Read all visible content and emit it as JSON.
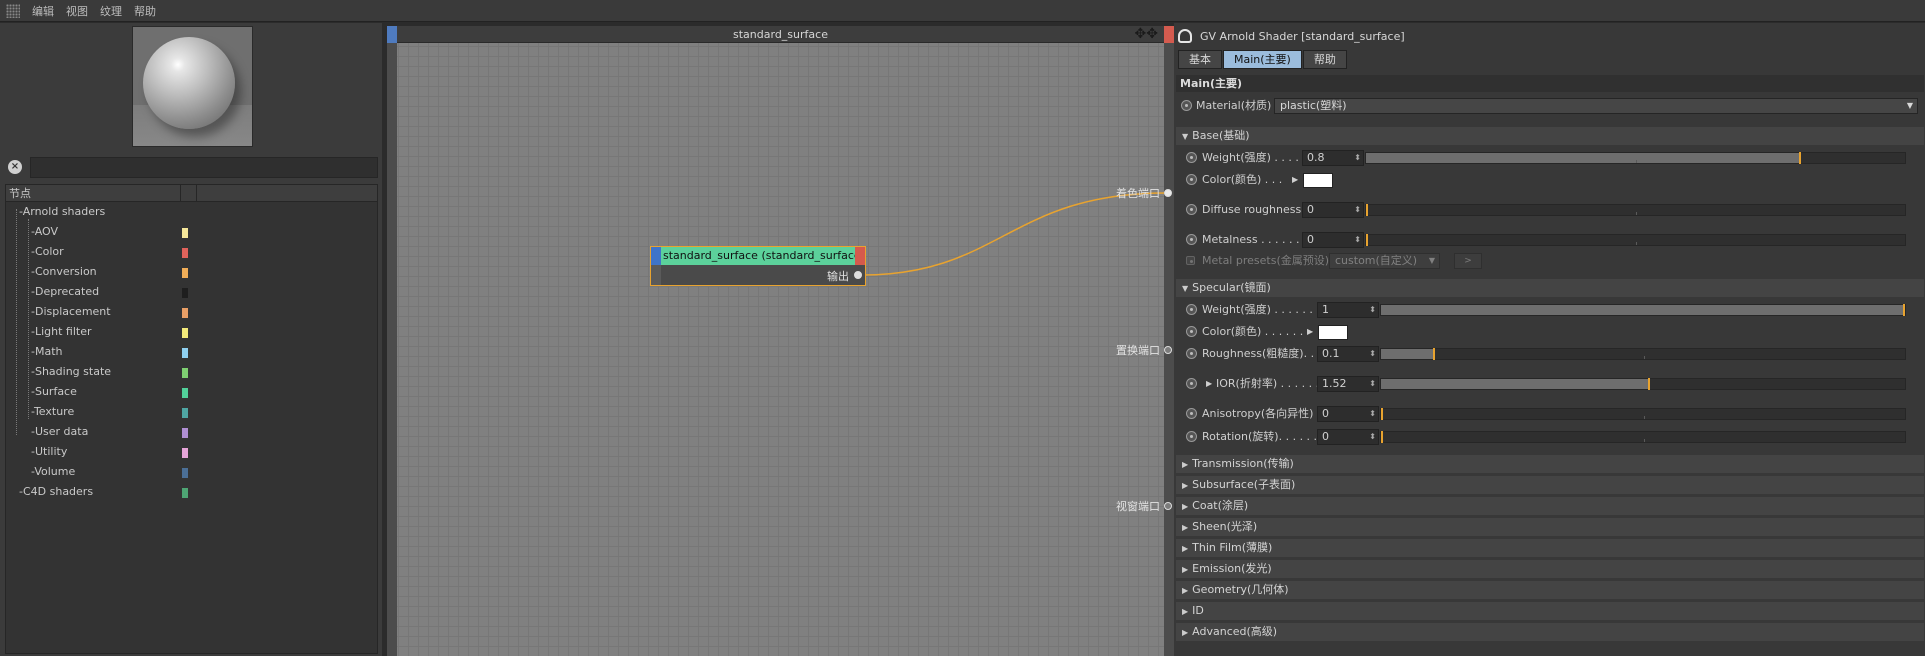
{
  "menubar": {
    "items": [
      "编辑",
      "视图",
      "纹理",
      "帮助"
    ]
  },
  "left": {
    "tree_header": "节点",
    "categories": [
      {
        "label": "-Arnold shaders"
      },
      {
        "label": "-AOV",
        "color": "#f6e79a"
      },
      {
        "label": "-Color",
        "color": "#e0635b"
      },
      {
        "label": "-Conversion",
        "color": "#f1ae58"
      },
      {
        "label": "-Deprecated",
        "color": "#1e1e1e"
      },
      {
        "label": "-Displacement",
        "color": "#e99f66"
      },
      {
        "label": "-Light filter",
        "color": "#f3ea7b"
      },
      {
        "label": "-Math",
        "color": "#8fd0f0"
      },
      {
        "label": "-Shading state",
        "color": "#7fcf72"
      },
      {
        "label": "-Surface",
        "color": "#52d19a"
      },
      {
        "label": "-Texture",
        "color": "#4fa6a3"
      },
      {
        "label": "-User data",
        "color": "#b08fd3"
      },
      {
        "label": "-Utility",
        "color": "#e6a5d8"
      },
      {
        "label": "-Volume",
        "color": "#4b6f96"
      },
      {
        "label": "-C4D shaders",
        "color": "#4ea574"
      }
    ]
  },
  "graph": {
    "title": "standard_surface",
    "node": {
      "title": "standard_surface (standard_surface)",
      "output_label": "输出"
    },
    "ports": [
      "着色端口",
      "置换端口",
      "视窗端口"
    ],
    "wire_color": "#e8a32f"
  },
  "right": {
    "title": "GV Arnold Shader [standard_surface]",
    "tabs": [
      "基本",
      "Main(主要)",
      "帮助"
    ],
    "active_tab": "Main(主要)",
    "section": "Main(主要)",
    "material": {
      "label": "Material(材质)",
      "value": "plastic(塑料)"
    },
    "base": {
      "header": "Base(基础)",
      "weight": {
        "label": "Weight(强度)  . . . .",
        "value": "0.8"
      },
      "color": {
        "label": "Color(颜色)  . . ."
      },
      "diffuse_roughness": {
        "label": "Diffuse roughness",
        "value": "0"
      },
      "metalness": {
        "label": "Metalness  . . . . . .",
        "value": "0"
      },
      "metal_presets": {
        "label": "Metal presets(金属预设)",
        "value": "custom(自定义)",
        "button": ">"
      }
    },
    "specular": {
      "header": "Specular(镜面)",
      "weight": {
        "label": "Weight(强度)  . . . . . . .",
        "value": "1"
      },
      "color": {
        "label": "Color(颜色)  . . . . . ."
      },
      "roughness": {
        "label": "Roughness(粗糙度). .",
        "value": "0.1"
      },
      "ior": {
        "label": "IOR(折射率)  . . . . . .",
        "value": "1.52"
      },
      "anisotropy": {
        "label": "Anisotropy(各向异性)",
        "value": "0"
      },
      "rotation": {
        "label": "Rotation(旋转). . . . . .",
        "value": "0"
      }
    },
    "collapsed_groups": [
      "Transmission(传输)",
      "Subsurface(子表面)",
      "Coat(涂层)",
      "Sheen(光泽)",
      "Thin Film(薄膜)",
      "Emission(发光)",
      "Geometry(几何体)",
      "ID",
      "Advanced(高级)"
    ]
  }
}
